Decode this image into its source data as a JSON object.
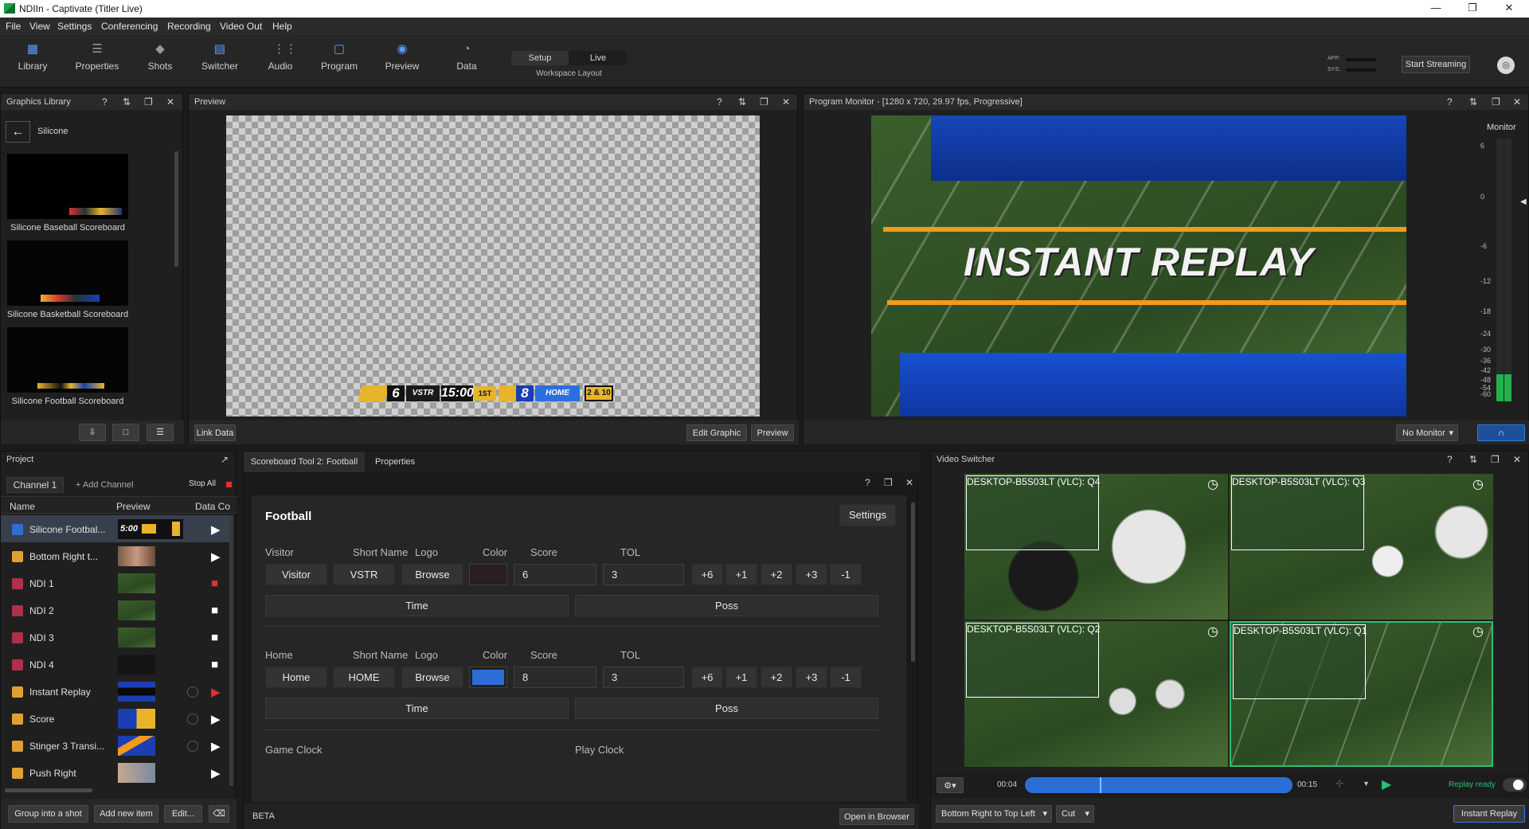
{
  "window": {
    "title": "NDIIn - Captivate (Titler Live)",
    "minimize": "—",
    "maximize": "❐",
    "close": "✕"
  },
  "menu": [
    "File",
    "View",
    "Settings",
    "Conferencing",
    "Recording",
    "Video Out",
    "Help"
  ],
  "toolbar": {
    "items": [
      {
        "label": "Library",
        "icon": "library-icon"
      },
      {
        "label": "Properties",
        "icon": "list-icon"
      },
      {
        "label": "Shots",
        "icon": "layers-icon"
      },
      {
        "label": "Switcher",
        "icon": "switcher-icon"
      },
      {
        "label": "Audio",
        "icon": "sliders-icon"
      },
      {
        "label": "Program",
        "icon": "monitor-icon"
      },
      {
        "label": "Preview",
        "icon": "eye-icon"
      },
      {
        "label": "Data",
        "icon": "pie-icon"
      }
    ],
    "mode_setup": "Setup",
    "mode_live": "Live",
    "workspace": "Workspace Layout",
    "app_label": "APP:",
    "sys_label": "SYS:",
    "start_streaming": "Start Streaming"
  },
  "library": {
    "title": "Graphics Library",
    "folder": "Silicone",
    "items": [
      "Silicone Baseball Scoreboard",
      "Silicone Basketball Scoreboard",
      "Silicone Football Scoreboard"
    ]
  },
  "preview": {
    "title": "Preview",
    "link_data": "Link Data",
    "edit_graphic": "Edit Graphic",
    "preview_btn": "Preview",
    "scoreboard": {
      "vscore": "6",
      "vname": "VSTR",
      "clock": "15:00",
      "period": "1ST",
      "hscore": "8",
      "hname": "HOME",
      "down": "2 & 10"
    }
  },
  "program": {
    "title": "Program Monitor - [1280 x 720, 29.97 fps, Progressive]",
    "overlay_text": "INSTANT REPLAY",
    "monitor_label": "Monitor",
    "no_monitor": "No Monitor",
    "scale": [
      "6",
      "0",
      "-6",
      "-12",
      "-18",
      "-24",
      "-30",
      "-36",
      "-42",
      "-48",
      "-54",
      "-60"
    ]
  },
  "project": {
    "title": "Project",
    "channel": "Channel 1",
    "add_channel": "+ Add Channel",
    "stop_all": "Stop All",
    "col_name": "Name",
    "col_preview": "Preview",
    "col_data": "Data Co",
    "rows": [
      {
        "name": "Silicone Footbal...",
        "thumb_text": "5:00"
      },
      {
        "name": "Bottom Right t..."
      },
      {
        "name": "NDI 1"
      },
      {
        "name": "NDI 2"
      },
      {
        "name": "NDI 3"
      },
      {
        "name": "NDI 4"
      },
      {
        "name": "Instant Replay"
      },
      {
        "name": "Score"
      },
      {
        "name": "Stinger 3 Transi..."
      },
      {
        "name": "Push Right"
      }
    ],
    "group_shot": "Group into a shot",
    "add_item": "Add new item",
    "edit": "Edit..."
  },
  "scoreboard_tool": {
    "tab_title": "Scoreboard Tool 2: Football",
    "tab_props": "Properties",
    "heading": "Football",
    "settings": "Settings",
    "labels": {
      "visitor": "Visitor",
      "home": "Home",
      "short_name": "Short Name",
      "logo": "Logo",
      "color": "Color",
      "score": "Score",
      "tol": "TOL",
      "game_clock": "Game Clock",
      "play_clock": "Play Clock"
    },
    "visitor": {
      "name": "Visitor",
      "short": "VSTR",
      "browse": "Browse",
      "color": "#2b1e1e",
      "score": "6",
      "tol": "3"
    },
    "home": {
      "name": "Home",
      "short": "HOME",
      "browse": "Browse",
      "color": "#2d6ed6",
      "score": "8",
      "tol": "3"
    },
    "increments": [
      "+6",
      "+1",
      "+2",
      "+3",
      "-1"
    ],
    "time": "Time",
    "poss": "Poss",
    "beta": "BETA",
    "open_browser": "Open in Browser"
  },
  "switcher": {
    "title": "Video Switcher",
    "sources": [
      "DESKTOP-B5S03LT (VLC): Q4",
      "DESKTOP-B5S03LT (VLC): Q3",
      "DESKTOP-B5S03LT (VLC): Q2",
      "DESKTOP-B5S03LT (VLC): Q1"
    ],
    "time_start": "00:04",
    "time_end": "00:15",
    "replay_ready": "Replay ready",
    "transition": "Bottom Right to Top Left",
    "cut": "Cut",
    "instant_replay": "Instant Replay"
  },
  "colors": {
    "accent": "#2f7de0",
    "live_green": "#2bbf73"
  }
}
